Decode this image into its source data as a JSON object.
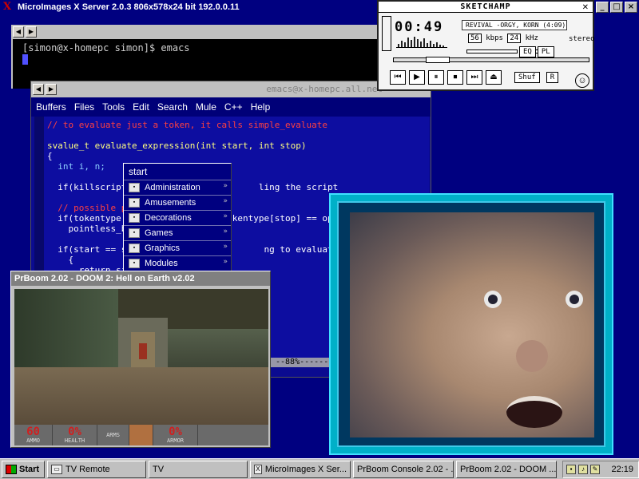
{
  "xserver": {
    "title": "MicroImages X Server 2.0.3  806x578x24 bit  192.0.0.11",
    "controls": [
      "_",
      "□",
      "×"
    ]
  },
  "terminal": {
    "prompt": "[simon@x-homepc simon]$ emacs",
    "left_arrow": "◀",
    "right_arrow": "▶"
  },
  "emacs": {
    "title": "emacs@x-homepc.all.net",
    "menu": [
      "Buffers",
      "Files",
      "Tools",
      "Edit",
      "Search",
      "Mule",
      "C++",
      "Help"
    ],
    "code": [
      "// to evaluate just a token, it calls simple_evaluate",
      "",
      "svalue_t evaluate_expression(int start, int stop)",
      "{",
      "  int i, n;",
      "",
      "  if(killscript)                        ling the script",
      "",
      "  // possible po",
      "  if(tokentype[s                  okentype[stop] == ope",
      "    pointless_br",
      "",
      "  if(start == st                         ng to evaluate",
      "    {",
      "      return sim"
    ],
    "modeline": "--88%-------"
  },
  "start_menu": {
    "header": "start",
    "items": [
      "Administration",
      "Amusements",
      "Decorations",
      "Games",
      "Graphics",
      "Modules"
    ]
  },
  "sketchamp": {
    "title": "SKETCHAMP",
    "time": "00:49",
    "song": "REVIVAL -ORGY, KORN  (4:09)",
    "kbps": "56",
    "khz": "24",
    "kbps_label": "kbps",
    "khz_label": "kHz",
    "stereo": "stereo",
    "eq": "EQ",
    "pl": "PL",
    "shuf": "Shuf",
    "rep": "R",
    "transport": [
      "⏮",
      "▶",
      "⏸",
      "⏹",
      "⏭",
      "⏏"
    ]
  },
  "doom": {
    "title": "PrBoom 2.02 - DOOM 2: Hell on Earth v2.02",
    "ammo": "60",
    "health": "0%",
    "armor": "0%",
    "labels": {
      "ammo": "AMMO",
      "health": "HEALTH",
      "arms": "ARMS",
      "armor": "ARMOR"
    }
  },
  "taskbar": {
    "start": "Start",
    "tasks": [
      "TV Remote",
      "TV",
      "MicroImages X Ser...",
      "PrBoom Console 2.02 - ...",
      "PrBoom 2.02 - DOOM ..."
    ],
    "clock": "22:19"
  }
}
